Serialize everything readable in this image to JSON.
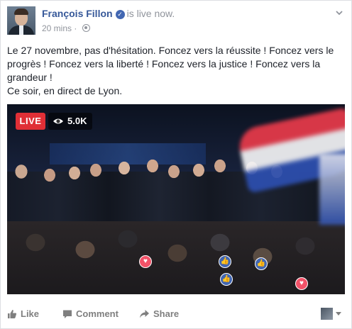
{
  "post": {
    "author": "François Fillon",
    "status": "is live now.",
    "timestamp": "20 mins",
    "separator": "·",
    "text_lines": [
      "Le 27 novembre, pas d'hésitation. Foncez vers la réussite ! Foncez vers le progrès ! Foncez vers la liberté ! Foncez vers la justice ! Foncez vers la grandeur !",
      "Ce soir, en direct de Lyon."
    ]
  },
  "video": {
    "live_label": "LIVE",
    "viewer_count": "5.0K"
  },
  "actions": {
    "like_label": "Like",
    "comment_label": "Comment",
    "share_label": "Share"
  },
  "icons": {
    "verified": "verified-badge-icon",
    "audience": "globe-icon",
    "menu": "chevron-down-icon",
    "viewers": "eye-icon",
    "like": "thumbs-up-icon",
    "comment": "comment-bubble-icon",
    "share": "share-arrow-icon"
  },
  "colors": {
    "link": "#365899",
    "live_red": "#e02f36",
    "muted": "#90949c",
    "action_gray": "#7f7f7f",
    "heart": "#f25268",
    "like_blue": "#4267b2"
  }
}
